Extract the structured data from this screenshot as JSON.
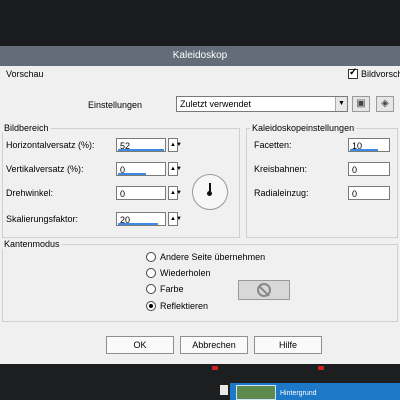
{
  "dialog": {
    "title": "Kaleidoskop",
    "preview_label": "Vorschau",
    "preview_checkbox_label": "Bildvorsch",
    "settings_label": "Einstellungen",
    "settings_value": "Zuletzt verwendet",
    "save_icon": "save-icon",
    "reset_icon": "reset-icon"
  },
  "bildbereich": {
    "title": "Bildbereich",
    "horizontal_label": "Horizontalversatz (%):",
    "horizontal_value": "52",
    "vertical_label": "Vertikalversatz (%):",
    "vertical_value": "0",
    "rotation_label": "Drehwinkel:",
    "rotation_value": "0",
    "scale_label": "Skalierungsfaktor:",
    "scale_value": "20"
  },
  "kaleido": {
    "title": "Kaleidoskopeinstellungen",
    "facets_label": "Facetten:",
    "facets_value": "10",
    "orbits_label": "Kreisbahnen:",
    "orbits_value": "0",
    "radial_label": "Radialeinzug:",
    "radial_value": "0"
  },
  "edge": {
    "title": "Kantenmodus",
    "options": [
      "Andere Seite übernehmen",
      "Wiederholen",
      "Farbe",
      "Reflektieren"
    ],
    "selected": "Reflektieren"
  },
  "buttons": {
    "ok": "OK",
    "cancel": "Abbrechen",
    "help": "Hilfe"
  },
  "taskbar": {
    "thumbnail_label": "Hintergrund"
  },
  "colors": {
    "titlebar": "#636c78",
    "dialog_bg": "#f0f0f0",
    "accent_blue": "#3c8be0",
    "layer_highlight": "#1e78c8"
  }
}
